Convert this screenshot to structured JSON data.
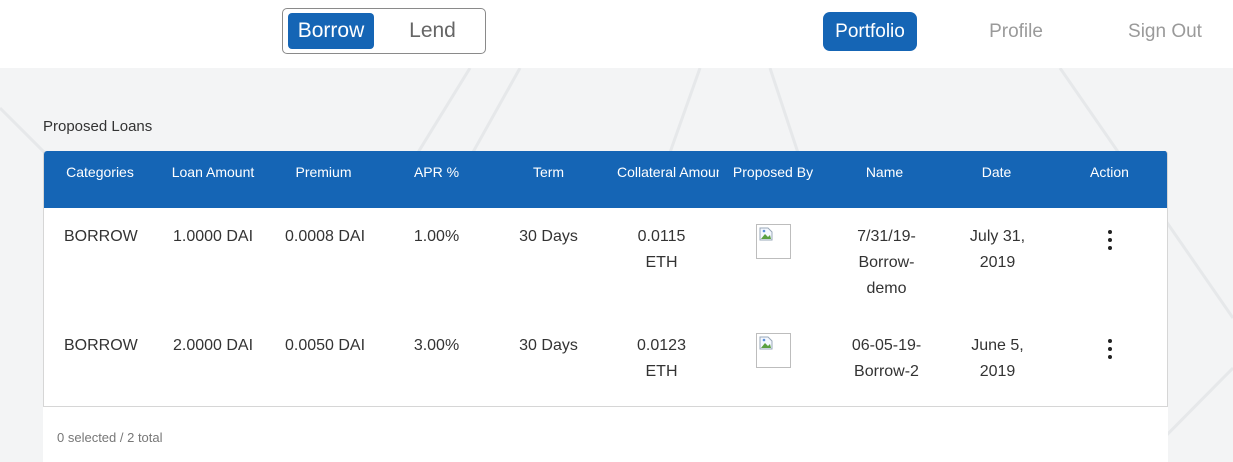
{
  "mode_toggle": {
    "borrow_label": "Borrow",
    "lend_label": "Lend",
    "active": "Borrow"
  },
  "nav": {
    "portfolio_label": "Portfolio",
    "profile_label": "Profile",
    "signout_label": "Sign Out"
  },
  "colors": {
    "primary": "#1565b5",
    "background": "#f3f4f5",
    "muted_text": "#9a9a9a"
  },
  "section": {
    "title": "Proposed Loans"
  },
  "table": {
    "columns": [
      "Categories",
      "Loan Amount",
      "Premium",
      "APR %",
      "Term",
      "Collateral Amount",
      "Proposed By",
      "Name",
      "Date",
      "Action"
    ],
    "rows": [
      {
        "category": "BORROW",
        "loan_amount": "1.0000 DAI",
        "premium": "0.0008 DAI",
        "apr": "1.00%",
        "term": "30 Days",
        "collateral_line1": "0.0115",
        "collateral_line2": "ETH",
        "proposed_by_icon": "broken-image-icon",
        "name_line1": "7/31/19-",
        "name_line2": "Borrow-",
        "name_line3": "demo",
        "date_line1": "July 31,",
        "date_line2": "2019",
        "action_icon": "kebab-menu-icon"
      },
      {
        "category": "BORROW",
        "loan_amount": "2.0000 DAI",
        "premium": "0.0050 DAI",
        "apr": "3.00%",
        "term": "30 Days",
        "collateral_line1": "0.0123",
        "collateral_line2": "ETH",
        "proposed_by_icon": "broken-image-icon",
        "name_line1": "06-05-19-",
        "name_line2": "Borrow-2",
        "date_line1": "June 5,",
        "date_line2": "2019",
        "action_icon": "kebab-menu-icon"
      }
    ]
  },
  "footer": {
    "status": "0 selected / 2 total"
  }
}
